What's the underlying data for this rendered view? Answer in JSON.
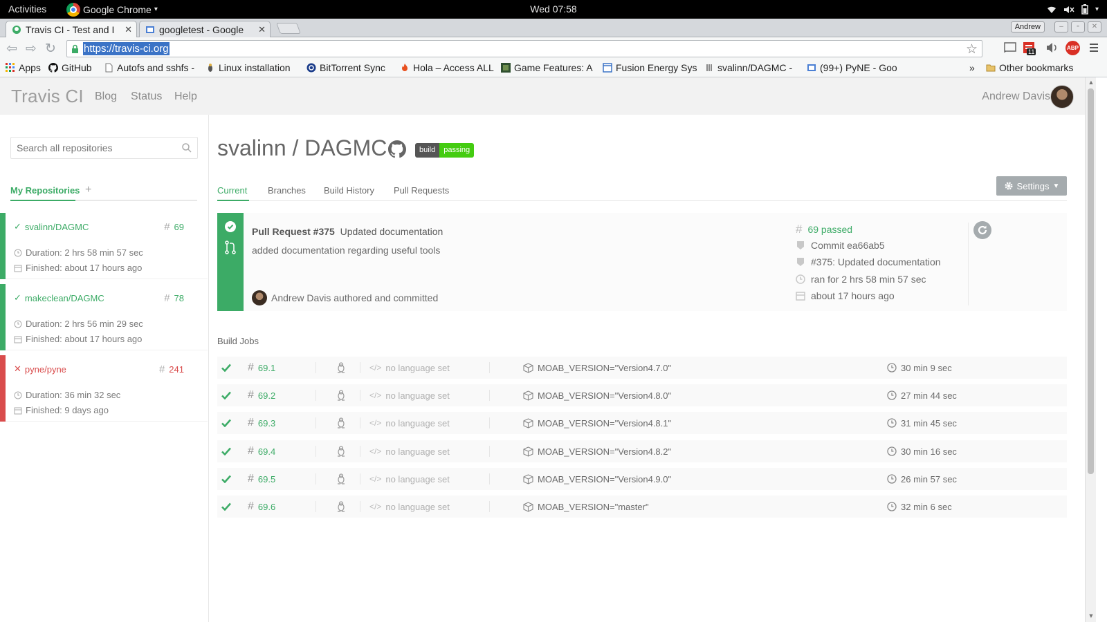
{
  "system_bar": {
    "activities": "Activities",
    "app_name": "Google Chrome",
    "clock": "Wed 07:58"
  },
  "browser": {
    "tabs": [
      {
        "title": "Travis CI - Test and I",
        "active": true
      },
      {
        "title": "googletest - Google",
        "active": false
      }
    ],
    "profile": "Andrew",
    "url": "https://travis-ci.org",
    "badge_count": "11",
    "abp_label": "ABP",
    "bookmarks": [
      {
        "label": "Apps"
      },
      {
        "label": "GitHub"
      },
      {
        "label": "Autofs and sshfs -"
      },
      {
        "label": "Linux installation"
      },
      {
        "label": "BitTorrent Sync"
      },
      {
        "label": "Hola – Access ALL"
      },
      {
        "label": "Game Features: A"
      },
      {
        "label": "Fusion Energy Sys"
      },
      {
        "label": "svalinn/DAGMC -"
      },
      {
        "label": "(99+) PyNE - Goo"
      }
    ],
    "overflow": "»",
    "other_bookmarks": "Other bookmarks"
  },
  "header": {
    "logo": "Travis CI",
    "nav": [
      "Blog",
      "Status",
      "Help"
    ],
    "user": "Andrew Davis"
  },
  "sidebar": {
    "search_placeholder": "Search all repositories",
    "tab": "My Repositories",
    "add": "+",
    "repos": [
      {
        "name": "svalinn/DAGMC",
        "number": "69",
        "status": "passed",
        "duration": "Duration: 2 hrs 58 min 57 sec",
        "finished": "Finished: about 17 hours ago"
      },
      {
        "name": "makeclean/DAGMC",
        "number": "78",
        "status": "passed",
        "duration": "Duration: 2 hrs 56 min 29 sec",
        "finished": "Finished: about 17 hours ago"
      },
      {
        "name": "pyne/pyne",
        "number": "241",
        "status": "failed",
        "duration": "Duration: 36 min 32 sec",
        "finished": "Finished: 9 days ago"
      }
    ]
  },
  "main": {
    "title": "svalinn / DAGMC",
    "badge": {
      "left": "build",
      "right": "passing"
    },
    "tabs": [
      "Current",
      "Branches",
      "Build History",
      "Pull Requests"
    ],
    "settings": "Settings",
    "build": {
      "pr_label": "Pull Request #375",
      "pr_title": "Updated documentation",
      "message": "added documentation regarding useful tools",
      "author": "Andrew Davis authored and committed",
      "result": "69 passed",
      "commit": "Commit ea66ab5",
      "pr_ref": "#375: Updated documentation",
      "ran_for": "ran for 2 hrs 58 min 57 sec",
      "when": "about 17 hours ago"
    },
    "jobs_label": "Build Jobs",
    "jobs": [
      {
        "number": "69.1",
        "language": "no language set",
        "env": "MOAB_VERSION=\"Version4.7.0\"",
        "duration": "30 min 9 sec"
      },
      {
        "number": "69.2",
        "language": "no language set",
        "env": "MOAB_VERSION=\"Version4.8.0\"",
        "duration": "27 min 44 sec"
      },
      {
        "number": "69.3",
        "language": "no language set",
        "env": "MOAB_VERSION=\"Version4.8.1\"",
        "duration": "31 min 45 sec"
      },
      {
        "number": "69.4",
        "language": "no language set",
        "env": "MOAB_VERSION=\"Version4.8.2\"",
        "duration": "30 min 16 sec"
      },
      {
        "number": "69.5",
        "language": "no language set",
        "env": "MOAB_VERSION=\"Version4.9.0\"",
        "duration": "26 min 57 sec"
      },
      {
        "number": "69.6",
        "language": "no language set",
        "env": "MOAB_VERSION=\"master\"",
        "duration": "32 min 6 sec"
      }
    ]
  },
  "colors": {
    "passed": "#3cab66",
    "failed": "#d94c4c",
    "badge_ok": "#44cc11",
    "selection": "#3b73c6"
  },
  "icons": [
    "search-icon",
    "github-icon",
    "gear-icon",
    "check-icon",
    "cross-icon",
    "clock-icon",
    "calendar-icon",
    "hash-icon",
    "commit-icon",
    "pull-request-icon",
    "restart-icon",
    "linux-icon",
    "code-icon",
    "package-icon",
    "lock-icon",
    "star-icon"
  ]
}
